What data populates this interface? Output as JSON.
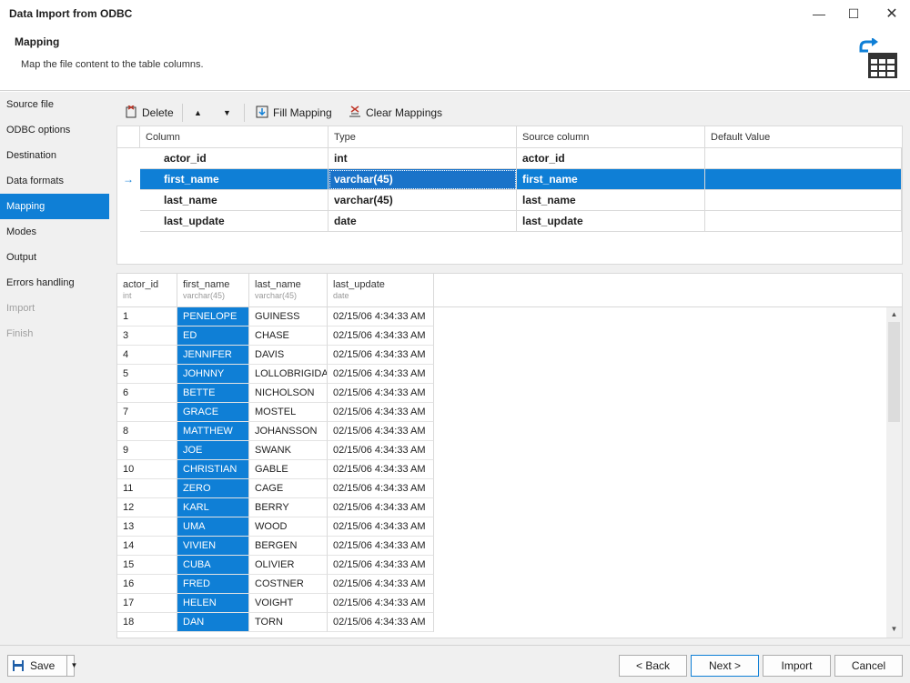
{
  "window": {
    "title": "Data Import from ODBC",
    "minimize": "—",
    "maximize": "☐",
    "close": "✕"
  },
  "header": {
    "title": "Mapping",
    "description": "Map the file content to the table columns."
  },
  "sidebar": {
    "items": [
      {
        "label": "Source file",
        "state": "normal"
      },
      {
        "label": "ODBC options",
        "state": "normal"
      },
      {
        "label": "Destination",
        "state": "normal"
      },
      {
        "label": "Data formats",
        "state": "normal"
      },
      {
        "label": "Mapping",
        "state": "active"
      },
      {
        "label": "Modes",
        "state": "normal"
      },
      {
        "label": "Output",
        "state": "normal"
      },
      {
        "label": "Errors handling",
        "state": "normal"
      },
      {
        "label": "Import",
        "state": "disabled"
      },
      {
        "label": "Finish",
        "state": "disabled"
      }
    ]
  },
  "toolbar": {
    "delete_label": "Delete",
    "up_glyph": "▲",
    "down_glyph": "▼",
    "fill_mapping_label": "Fill Mapping",
    "clear_mappings_label": "Clear Mappings"
  },
  "mapping": {
    "headers": {
      "column": "Column",
      "type": "Type",
      "source": "Source column",
      "default": "Default Value"
    },
    "current_row_glyph": "→",
    "rows": [
      {
        "column": "actor_id",
        "type": "int",
        "source": "actor_id",
        "default": ""
      },
      {
        "column": "first_name",
        "type": "varchar(45)",
        "source": "first_name",
        "default": ""
      },
      {
        "column": "last_name",
        "type": "varchar(45)",
        "source": "last_name",
        "default": ""
      },
      {
        "column": "last_update",
        "type": "date",
        "source": "last_update",
        "default": ""
      }
    ]
  },
  "preview": {
    "columns": [
      {
        "name": "actor_id",
        "type": "int"
      },
      {
        "name": "first_name",
        "type": "varchar(45)"
      },
      {
        "name": "last_name",
        "type": "varchar(45)"
      },
      {
        "name": "last_update",
        "type": "date"
      }
    ],
    "rows": [
      [
        "1",
        "PENELOPE",
        "GUINESS",
        "02/15/06 4:34:33 AM"
      ],
      [
        "3",
        "ED",
        "CHASE",
        "02/15/06 4:34:33 AM"
      ],
      [
        "4",
        "JENNIFER",
        "DAVIS",
        "02/15/06 4:34:33 AM"
      ],
      [
        "5",
        "JOHNNY",
        "LOLLOBRIGIDA",
        "02/15/06 4:34:33 AM"
      ],
      [
        "6",
        "BETTE",
        "NICHOLSON",
        "02/15/06 4:34:33 AM"
      ],
      [
        "7",
        "GRACE",
        "MOSTEL",
        "02/15/06 4:34:33 AM"
      ],
      [
        "8",
        "MATTHEW",
        "JOHANSSON",
        "02/15/06 4:34:33 AM"
      ],
      [
        "9",
        "JOE",
        "SWANK",
        "02/15/06 4:34:33 AM"
      ],
      [
        "10",
        "CHRISTIAN",
        "GABLE",
        "02/15/06 4:34:33 AM"
      ],
      [
        "11",
        "ZERO",
        "CAGE",
        "02/15/06 4:34:33 AM"
      ],
      [
        "12",
        "KARL",
        "BERRY",
        "02/15/06 4:34:33 AM"
      ],
      [
        "13",
        "UMA",
        "WOOD",
        "02/15/06 4:34:33 AM"
      ],
      [
        "14",
        "VIVIEN",
        "BERGEN",
        "02/15/06 4:34:33 AM"
      ],
      [
        "15",
        "CUBA",
        "OLIVIER",
        "02/15/06 4:34:33 AM"
      ],
      [
        "16",
        "FRED",
        "COSTNER",
        "02/15/06 4:34:33 AM"
      ],
      [
        "17",
        "HELEN",
        "VOIGHT",
        "02/15/06 4:34:33 AM"
      ],
      [
        "18",
        "DAN",
        "TORN",
        "02/15/06 4:34:33 AM"
      ]
    ],
    "scroll_up_glyph": "▲",
    "scroll_down_glyph": "▼"
  },
  "footer": {
    "save_label": "Save",
    "save_dropdown_glyph": "▼",
    "back_label": "< Back",
    "next_label": "Next >",
    "import_label": "Import",
    "cancel_label": "Cancel"
  },
  "colors": {
    "accent": "#0f7fd6",
    "panel": "#f0f0f0"
  }
}
